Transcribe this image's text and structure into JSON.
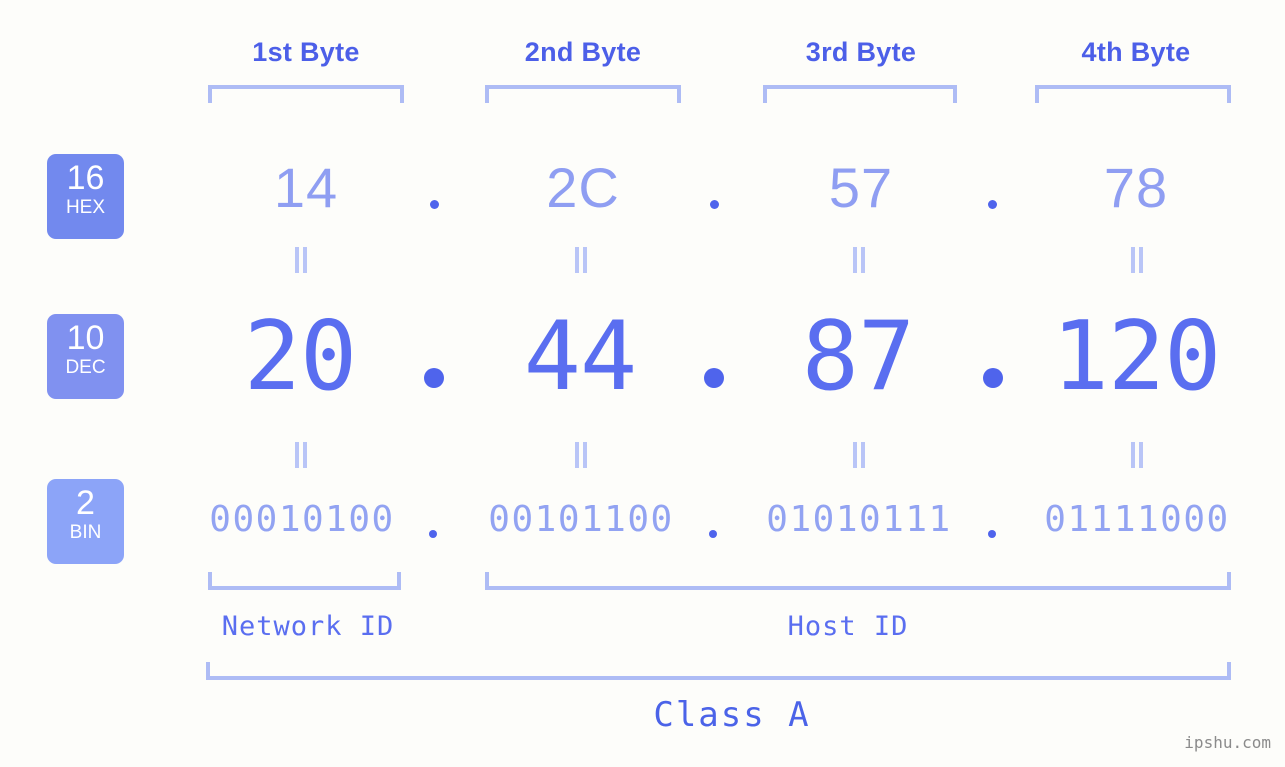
{
  "page": {
    "background_color": "#fdfdfa",
    "watermark": "ipshu.com"
  },
  "colors": {
    "header_label": "#4c5fe8",
    "bracket": "#aebcf5",
    "dot": "#4f64ec",
    "equals": "#b9c5f7",
    "hex_value": "#8f9ef2",
    "dec_value": "#5a6ef0",
    "bin_value": "#92a3f2",
    "badge_hex": "#7289ee",
    "badge_dec": "#8091f0",
    "badge_bin": "#8ca4f8",
    "class_label": "#4b63e8",
    "watermark": "#8b8b8b"
  },
  "byte_headers": [
    {
      "label": "1st Byte"
    },
    {
      "label": "2nd Byte"
    },
    {
      "label": "3rd Byte"
    },
    {
      "label": "4th Byte"
    }
  ],
  "radix_badges": [
    {
      "number": "16",
      "word": "HEX",
      "color": "#7289ee"
    },
    {
      "number": "10",
      "word": "DEC",
      "color": "#8091f0"
    },
    {
      "number": "2",
      "word": "BIN",
      "color": "#8ca4f8"
    }
  ],
  "separators": {
    "dot": "."
  },
  "equality_symbol": "=",
  "rows": {
    "hex": {
      "radix": "16",
      "name": "HEX",
      "values": [
        "14",
        "2C",
        "57",
        "78"
      ],
      "joined": "14.2C.57.78"
    },
    "dec": {
      "radix": "10",
      "name": "DEC",
      "values": [
        "20",
        "44",
        "87",
        "120"
      ],
      "joined": "20.44.87.120"
    },
    "bin": {
      "radix": "2",
      "name": "BIN",
      "values": [
        "00010100",
        "00101100",
        "01010111",
        "01111000"
      ],
      "joined": "00010100.00101100.01010111.01111000"
    }
  },
  "partitions": [
    {
      "label": "Network ID",
      "bytes": [
        1
      ]
    },
    {
      "label": "Host ID",
      "bytes": [
        2,
        3,
        4
      ]
    }
  ],
  "class": {
    "label": "Class A"
  }
}
